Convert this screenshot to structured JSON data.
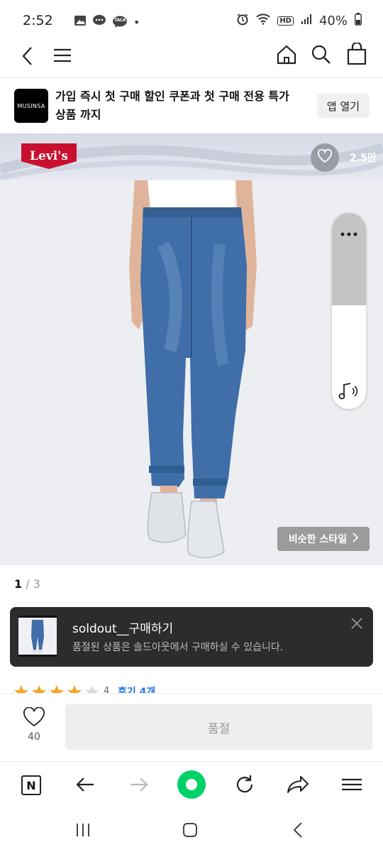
{
  "status_bar": {
    "time": "2:52",
    "battery": "40%",
    "dot": "•",
    "icons_left": [
      "image-icon",
      "chat-bubble-icon",
      "talk-icon"
    ],
    "icons_right": [
      "alarm-icon",
      "wifi-icon",
      "hd-icon",
      "signal-icon",
      "battery-icon"
    ],
    "talk_label": "TALK",
    "hd_label": "HD"
  },
  "nav": {
    "icons": [
      "back-icon",
      "menu-icon",
      "home-icon",
      "search-icon",
      "cart-icon"
    ]
  },
  "app_banner": {
    "logo_text": "MUSINSA",
    "message": "가입 즉시 첫 구매 할인 쿠폰과 첫 구매 전용 특가 상품 까지",
    "button": "앱 열기"
  },
  "brand": {
    "logo_text": "Levi's",
    "like_count": "2.5만"
  },
  "similar_style": "비슷한 스타일",
  "pager": {
    "current": "1",
    "total": "/ 3"
  },
  "rating_peek": {
    "count": "4",
    "review_label": "후기 4개"
  },
  "toast": {
    "title": "soldout__구매하기",
    "message": "품절된 상품은 솔드아웃에서 구매하실 수 있습니다."
  },
  "buy_bar": {
    "wish_count": "40",
    "button": "품절"
  },
  "browser_bar": {
    "icons": [
      "naver-icon",
      "back-arrow-icon",
      "forward-arrow-icon",
      "home-dot-icon",
      "refresh-icon",
      "share-icon",
      "hamburger-icon"
    ],
    "n_label": "N"
  },
  "android_nav": {
    "icons": [
      "recents-icon",
      "home-icon",
      "back-icon"
    ]
  },
  "colors": {
    "levis_red": "#c8102e",
    "toast_bg": "#2c2c2c",
    "green_dot": "#00d26a",
    "star": "#f5a623",
    "review_link": "#1e73e8"
  }
}
